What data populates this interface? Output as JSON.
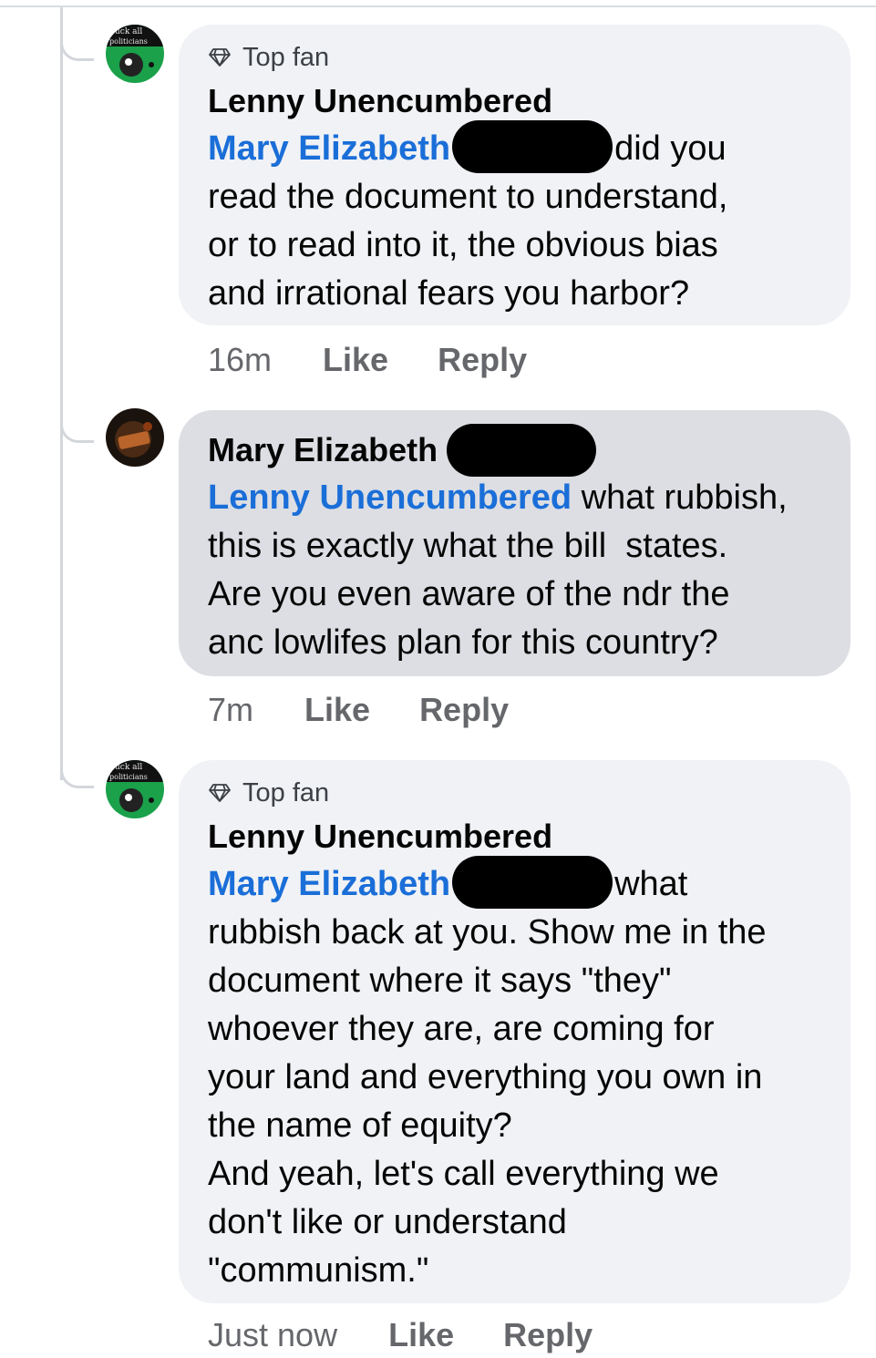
{
  "comments": [
    {
      "badge_icon": "diamond-icon",
      "badge": "Top fan",
      "author": "Lenny Unencumbered",
      "mention": "Mary Elizabeth",
      "text_first": "did you",
      "text_rest": "read the document to understand,\nor to read into it, the obvious bias\nand irrational fears you harbor?",
      "time": "16m",
      "like": "Like",
      "reply": "Reply"
    },
    {
      "author": "Mary Elizabeth",
      "mention": "Lenny Unencumbered",
      "text_first": " what rubbish,",
      "text_rest": "this is exactly what the bill  states.\nAre you even aware of the ndr the\nanc lowlifes plan for this country?",
      "time": "7m",
      "like": "Like",
      "reply": "Reply"
    },
    {
      "badge_icon": "diamond-icon",
      "badge": "Top fan",
      "author": "Lenny Unencumbered",
      "mention": "Mary Elizabeth",
      "text_first": "what",
      "text_rest": "rubbish back at you. Show me in the\ndocument where it says \"they\"\nwhoever they are, are coming for\nyour land and everything you own in\nthe name of equity?\nAnd yeah, let's call everything we\ndon't like or understand\n\"communism.\"",
      "time": "Just now",
      "like": "Like",
      "reply": "Reply"
    }
  ],
  "avatars": {
    "lenny_text_top": "uck all",
    "lenny_text_bottom": "politicians"
  },
  "colors": {
    "mention": "#1a6ed8",
    "bubble": "#f0f2f5",
    "bubble_selected": "#dcdee3",
    "meta": "#65676b"
  }
}
